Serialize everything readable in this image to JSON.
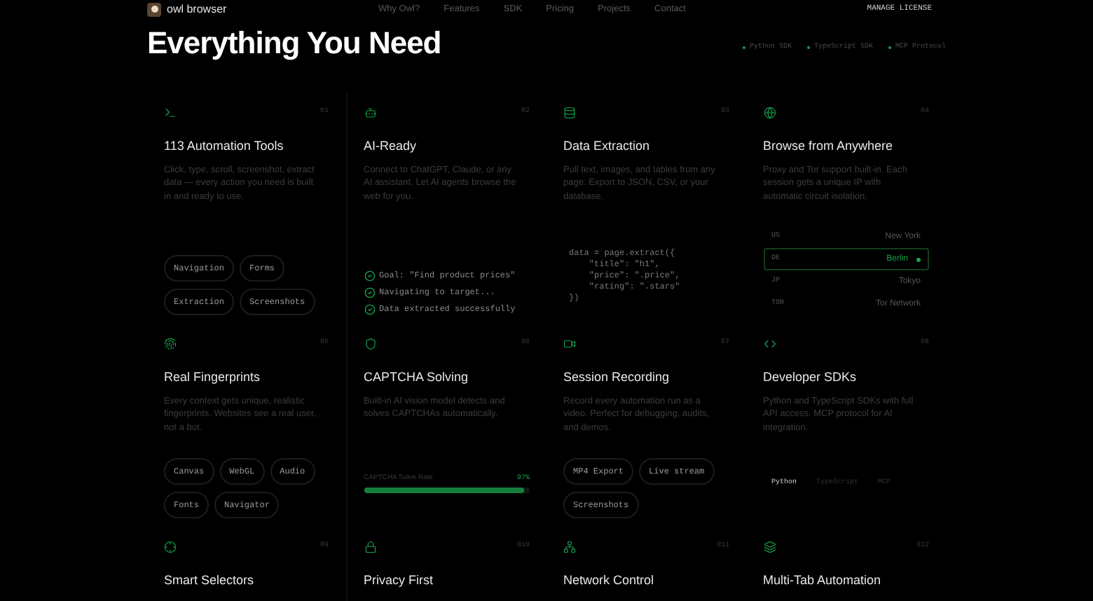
{
  "header": {
    "brand": "owl browser",
    "nav": [
      {
        "label": "Why Owl?"
      },
      {
        "label": "Features"
      },
      {
        "label": "SDK"
      },
      {
        "label": "Pricing"
      },
      {
        "label": "Projects"
      },
      {
        "label": "Contact"
      }
    ],
    "action": "MANAGE LICENSE"
  },
  "hero": {
    "title": "Everything You Need",
    "badges": [
      {
        "label": "Python SDK",
        "color": "#16a34a"
      },
      {
        "label": "TypeScript SDK",
        "color": "#16a34a"
      },
      {
        "label": "MCP Protocol",
        "color": "#16a34a"
      }
    ]
  },
  "cards": [
    {
      "number": "01",
      "title": "113 Automation Tools",
      "description": "Click, type, scroll, screenshot, extract data — every action you need is built in and ready to use.",
      "kind": "tags",
      "tags": [
        "Navigation",
        "Forms",
        "Extraction",
        "Screenshots"
      ]
    },
    {
      "number": "02",
      "title": "AI-Ready",
      "description": "Connect to ChatGPT, Claude, or any AI assistant. Let AI agents browse the web for you.",
      "kind": "steps",
      "steps": [
        {
          "text": "Goal: \"Find product prices\"",
          "done": true
        },
        {
          "text": "Navigating to target...",
          "done": true
        },
        {
          "text": "Data extracted successfully",
          "done": true
        }
      ]
    },
    {
      "number": "03",
      "title": "Data Extraction",
      "description": "Pull text, images, and tables from any page. Export to JSON, CSV, or your database.",
      "kind": "code",
      "code": "data = page.extract({\n    \"title\": \"h1\",\n    \"price\": \".price\",\n    \"rating\": \".stars\"\n})"
    },
    {
      "number": "04",
      "title": "Browse from Anywhere",
      "description": "Proxy and Tor support built-in. Each session gets a unique IP with automatic circuit isolation.",
      "kind": "locations",
      "locations": [
        {
          "code": "US",
          "city": "New York",
          "selected": false
        },
        {
          "code": "DE",
          "city": "Berlin",
          "selected": true
        },
        {
          "code": "JP",
          "city": "Tokyo",
          "selected": false
        },
        {
          "code": "TOR",
          "city": "Tor Network",
          "selected": false
        }
      ]
    },
    {
      "number": "05",
      "title": "Real Fingerprints",
      "description": "Every context gets unique, realistic fingerprints. Websites see a real user, not a bot.",
      "kind": "tags",
      "tags": [
        "Canvas",
        "WebGL",
        "Audio",
        "Fonts",
        "Navigator"
      ]
    },
    {
      "number": "06",
      "title": "CAPTCHA Solving",
      "description": "Built-in AI vision model detects and solves CAPTCHAs automatically.",
      "kind": "progress",
      "progress": {
        "label": "CAPTCHA Solve Rate",
        "reading": "97%",
        "level": 0.97
      }
    },
    {
      "number": "07",
      "title": "Session Recording",
      "description": "Record every automation run as a video. Perfect for debugging, audits, and demos.",
      "kind": "tags",
      "tags": [
        "MP4 Export",
        "Live stream",
        "Screenshots"
      ]
    },
    {
      "number": "08",
      "title": "Developer SDKs",
      "description": "Python and TypeScript SDKs with full API access. MCP protocol for AI integration.",
      "kind": "sdks",
      "sdks": [
        {
          "label": "Python",
          "selected": true
        },
        {
          "label": "TypeScript",
          "selected": false
        },
        {
          "label": "MCP",
          "selected": false
        }
      ]
    },
    {
      "number": "09",
      "title": "Smart Selectors",
      "kind": "stub"
    },
    {
      "number": "010",
      "title": "Privacy First",
      "kind": "stub"
    },
    {
      "number": "011",
      "title": "Network Control",
      "kind": "stub"
    },
    {
      "number": "012",
      "title": "Multi-Tab Automation",
      "kind": "stub"
    }
  ]
}
